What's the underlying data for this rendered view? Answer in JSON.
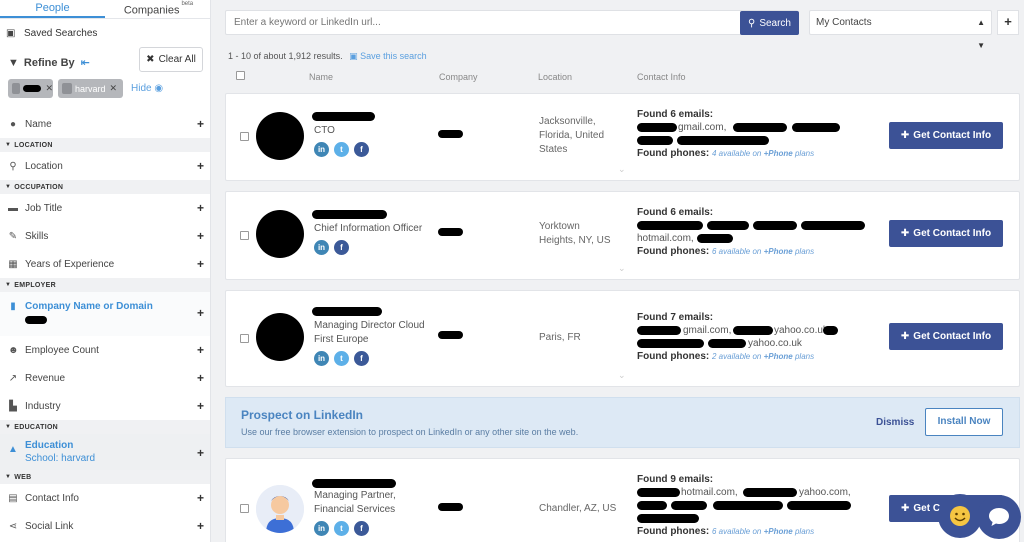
{
  "sidebar": {
    "tabs": [
      {
        "label": "People",
        "active": true
      },
      {
        "label": "Companies",
        "badge": "beta"
      }
    ],
    "saved_searches": "Saved Searches",
    "refine_by": "Refine By",
    "clear_all": "Clear All",
    "chips": [
      {
        "label": "",
        "redacted": true
      },
      {
        "label": "harvard"
      }
    ],
    "hide_label": "Hide",
    "filters": {
      "name": "Name",
      "location_section": "LOCATION",
      "location": "Location",
      "occupation_section": "OCCUPATION",
      "job_title": "Job Title",
      "skills": "Skills",
      "years_experience": "Years of Experience",
      "employer_section": "EMPLOYER",
      "company_name": "Company Name or Domain",
      "employee_count": "Employee Count",
      "revenue": "Revenue",
      "industry": "Industry",
      "education_section": "EDUCATION",
      "education": "Education",
      "education_value": "School: harvard",
      "web_section": "WEB",
      "contact_info": "Contact Info",
      "social_link": "Social Link"
    }
  },
  "toolbar": {
    "search_placeholder": "Enter a keyword or LinkedIn url...",
    "search_button": "Search",
    "list_select": "My Contacts",
    "add_button": "+"
  },
  "results": {
    "summary": "1 - 10 of about 1,912 results.",
    "save_search": "Save this search",
    "columns": [
      "Name",
      "Company",
      "Location",
      "Contact Info"
    ]
  },
  "people": [
    {
      "title": "CTO",
      "location": "Jacksonville, Florida, United States",
      "emails_found": "Found 6 emails:",
      "phones_label": "Found phones:",
      "phones_avail": "4 available on",
      "phone_plan": "+Phone",
      "plans": "plans",
      "button": "Get Contact Info",
      "email_domains": [
        "gmail.com,"
      ]
    },
    {
      "title": "Chief Information Officer",
      "location": "Yorktown Heights, NY, US",
      "emails_found": "Found 6 emails:",
      "phones_label": "Found phones:",
      "phones_avail": "6 available on",
      "phone_plan": "+Phone",
      "plans": "plans",
      "button": "Get Contact Info",
      "email_domains": [
        "hotmail.com,"
      ]
    },
    {
      "title": "Managing Director Cloud First Europe",
      "location": "Paris, FR",
      "emails_found": "Found 7 emails:",
      "phones_label": "Found phones:",
      "phones_avail": "2 available on",
      "phone_plan": "+Phone",
      "plans": "plans",
      "button": "Get Contact Info",
      "email_domains": [
        "gmail.com,",
        "yahoo.co.uk"
      ]
    },
    {
      "title": "Managing Partner, Financial Services",
      "location": "Chandler, AZ, US",
      "emails_found": "Found 9 emails:",
      "phones_label": "Found phones:",
      "phones_avail": "6 available on",
      "phone_plan": "+Phone",
      "plans": "plans",
      "button": "Get C"
    }
  ],
  "promo": {
    "title": "Prospect on LinkedIn",
    "description": "Use our free browser extension to prospect on LinkedIn or any other site on the web.",
    "dismiss": "Dismiss",
    "install": "Install Now"
  },
  "colors": {
    "primary": "#3c5296",
    "accent": "#3d8fd6",
    "promo_bg": "#dde9f5"
  }
}
